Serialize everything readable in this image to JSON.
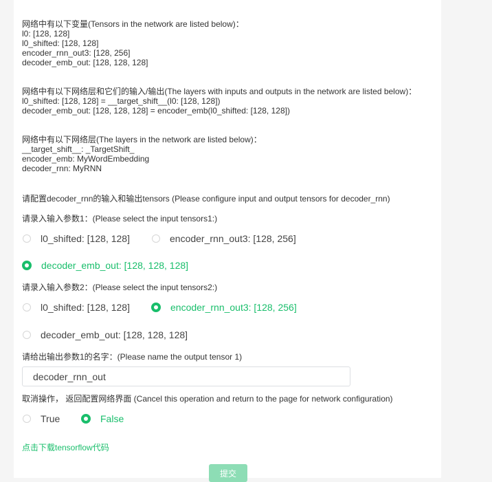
{
  "info": {
    "tensors_header": "网络中有以下变量(Tensors in the network are listed below)：",
    "tensors": [
      "l0: [128, 128]",
      "l0_shifted: [128, 128]",
      "encoder_rnn_out3: [128, 256]",
      "decoder_emb_out: [128, 128, 128]"
    ],
    "layers_io_header": "网络中有以下网络层和它们的输入/输出(The layers with inputs and outputs in the network are listed below)：",
    "layers_io": [
      "l0_shifted: [128, 128] = __target_shift__(l0: [128, 128])",
      "decoder_emb_out: [128, 128, 128] = encoder_emb(l0_shifted: [128, 128])"
    ],
    "layers_header": "网络中有以下网络层(The layers in the network are listed below)：",
    "layers": [
      "__target_shift__: _TargetShift_",
      "encoder_emb: MyWordEmbedding",
      "decoder_rnn: MyRNN"
    ]
  },
  "configure_title": "请配置decoder_rnn的输入和输出tensors (Please configure input and output tensors for decoder_rnn)",
  "input1": {
    "prompt": "请录入输入参数1：(Please select the input tensors1:)",
    "options": [
      "l0_shifted: [128, 128]",
      "encoder_rnn_out3: [128, 256]",
      "decoder_emb_out: [128, 128, 128]"
    ],
    "selected": "decoder_emb_out: [128, 128, 128]"
  },
  "input2": {
    "prompt": "请录入输入参数2：(Please select the input tensors2:)",
    "options": [
      "l0_shifted: [128, 128]",
      "encoder_rnn_out3: [128, 256]",
      "decoder_emb_out: [128, 128, 128]"
    ],
    "selected": "encoder_rnn_out3: [128, 256]"
  },
  "output": {
    "prompt": "请给出输出参数1的名字：(Please name the output tensor 1)",
    "value": "decoder_rnn_out"
  },
  "cancel": {
    "prompt": "取消操作， 返回配置网络界面 (Cancel this operation and return to the page for network configuration)",
    "options": [
      "True",
      "False"
    ],
    "selected": "False"
  },
  "download_link": "点击下载tensorflow代码",
  "submit_label": "提交",
  "colors": {
    "accent": "#19be6b",
    "submit_bg": "#8dddb5",
    "page_bg": "#f5f5f5",
    "card_bg": "#ffffff"
  }
}
